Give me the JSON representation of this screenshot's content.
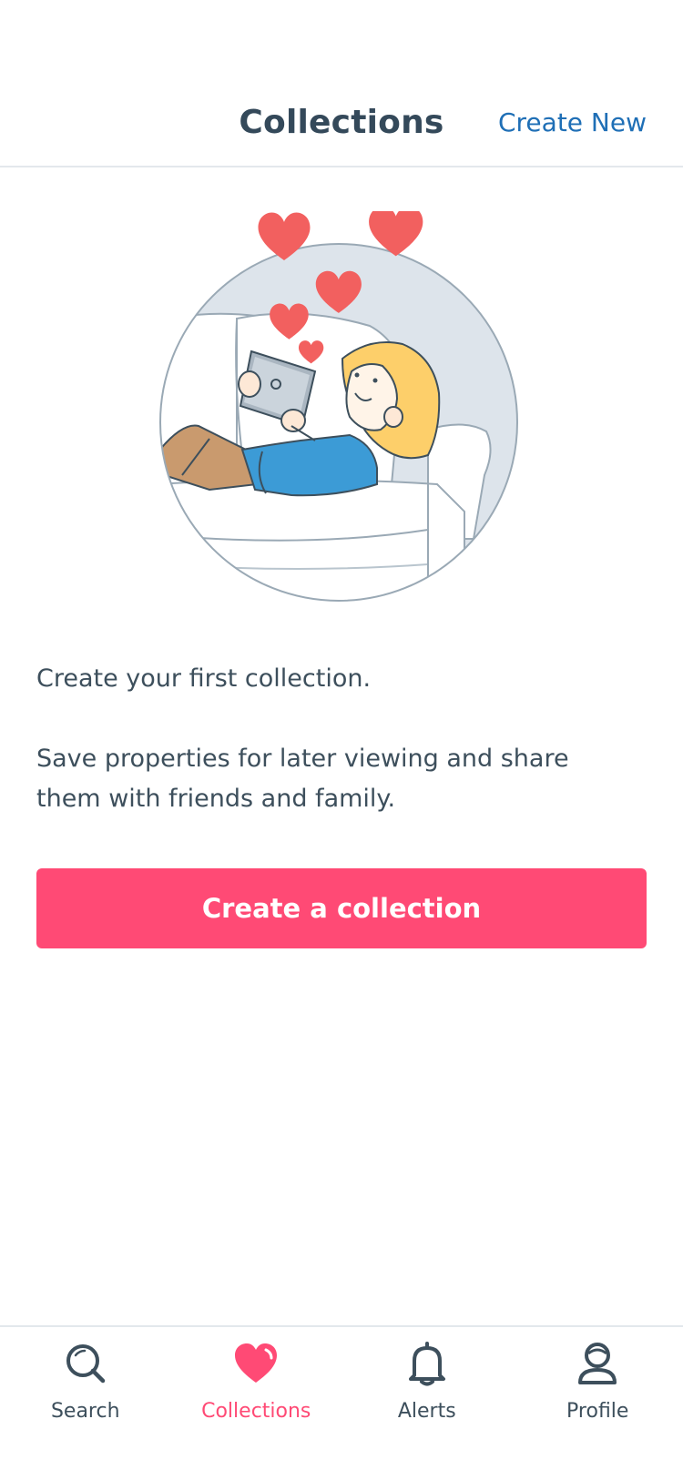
{
  "header": {
    "title": "Collections",
    "action_label": "Create New"
  },
  "empty_state": {
    "heading": "Create your first collection.",
    "description": "Save properties for later viewing and share them with friends and family.",
    "button_label": "Create a collection"
  },
  "tabs": [
    {
      "label": "Search",
      "icon": "search-icon",
      "active": false
    },
    {
      "label": "Collections",
      "icon": "heart-icon",
      "active": true
    },
    {
      "label": "Alerts",
      "icon": "bell-icon",
      "active": false
    },
    {
      "label": "Profile",
      "icon": "profile-icon",
      "active": false
    }
  ],
  "colors": {
    "accent": "#ff4a75",
    "link": "#1f6fb6",
    "text": "#3d4f5c",
    "heart": "#f2605f"
  }
}
